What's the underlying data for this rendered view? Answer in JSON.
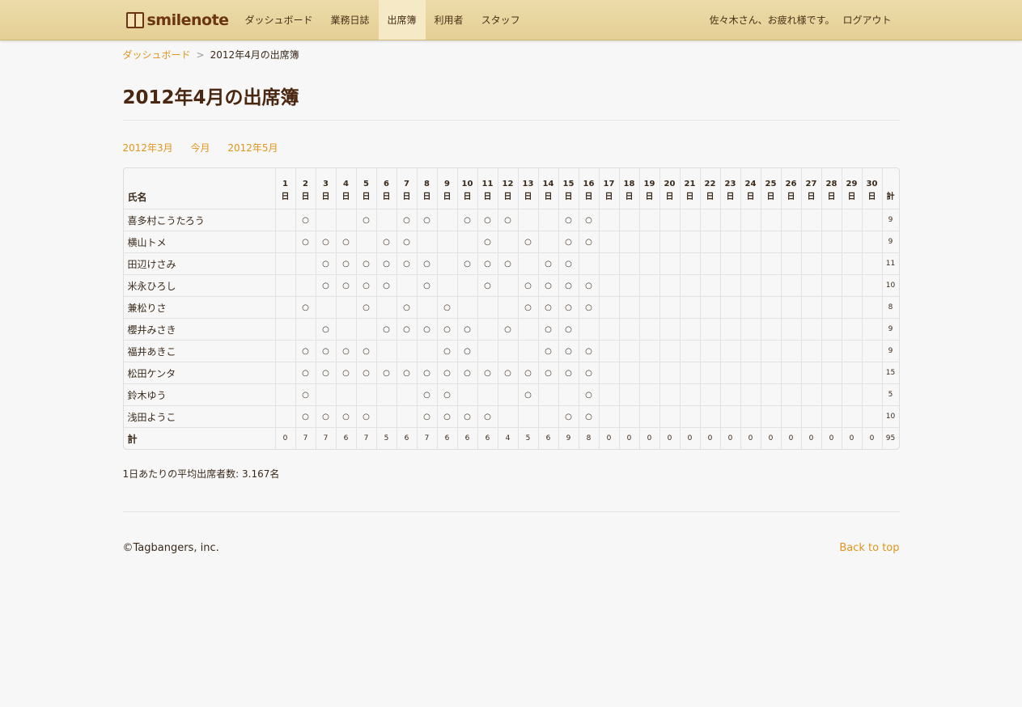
{
  "nav": {
    "brand": "smilenote",
    "items": [
      {
        "label": "ダッシュボード",
        "active": false
      },
      {
        "label": "業務日誌",
        "active": false
      },
      {
        "label": "出席簿",
        "active": true
      },
      {
        "label": "利用者",
        "active": false
      },
      {
        "label": "スタッフ",
        "active": false
      }
    ],
    "greeting": "佐々木さん、お疲れ様です。",
    "logout": "ログアウト"
  },
  "breadcrumb": {
    "home": "ダッシュボード",
    "separator": ">",
    "current": "2012年4月の出席簿"
  },
  "page_title": "2012年4月の出席簿",
  "month_nav": {
    "prev": "2012年3月",
    "current": "今月",
    "next": "2012年5月"
  },
  "table": {
    "name_header": "氏名",
    "day_suffix": "日",
    "total_header": "計",
    "mark": "○",
    "days": [
      1,
      2,
      3,
      4,
      5,
      6,
      7,
      8,
      9,
      10,
      11,
      12,
      13,
      14,
      15,
      16,
      17,
      18,
      19,
      20,
      21,
      22,
      23,
      24,
      25,
      26,
      27,
      28,
      29,
      30
    ],
    "rows": [
      {
        "name": "喜多村こうたろう",
        "days": [
          2,
          5,
          7,
          8,
          10,
          11,
          12,
          15,
          16
        ],
        "total": 9
      },
      {
        "name": "横山トメ",
        "days": [
          2,
          3,
          4,
          6,
          7,
          11,
          13,
          15,
          16
        ],
        "total": 9
      },
      {
        "name": "田辺けさみ",
        "days": [
          3,
          4,
          5,
          6,
          7,
          8,
          10,
          11,
          12,
          14,
          15
        ],
        "total": 11
      },
      {
        "name": "米永ひろし",
        "days": [
          3,
          4,
          5,
          6,
          8,
          11,
          13,
          14,
          15,
          16
        ],
        "total": 10
      },
      {
        "name": "兼松りさ",
        "days": [
          2,
          5,
          7,
          9,
          13,
          14,
          15,
          16
        ],
        "total": 8
      },
      {
        "name": "櫻井みさき",
        "days": [
          3,
          6,
          7,
          8,
          9,
          10,
          12,
          14,
          15
        ],
        "total": 9
      },
      {
        "name": "福井あきこ",
        "days": [
          2,
          3,
          4,
          5,
          9,
          10,
          14,
          15,
          16
        ],
        "total": 9
      },
      {
        "name": "松田ケンタ",
        "days": [
          2,
          3,
          4,
          5,
          6,
          7,
          8,
          9,
          10,
          11,
          12,
          13,
          14,
          15,
          16
        ],
        "total": 15
      },
      {
        "name": "鈴木ゆう",
        "days": [
          2,
          8,
          9,
          13,
          16
        ],
        "total": 5
      },
      {
        "name": "浅田ようこ",
        "days": [
          2,
          3,
          4,
          5,
          8,
          9,
          10,
          11,
          15,
          16
        ],
        "total": 10
      }
    ],
    "sum_label": "計",
    "day_totals": [
      0,
      7,
      7,
      6,
      7,
      5,
      6,
      7,
      6,
      6,
      6,
      4,
      5,
      6,
      9,
      8,
      0,
      0,
      0,
      0,
      0,
      0,
      0,
      0,
      0,
      0,
      0,
      0,
      0,
      0
    ],
    "grand_total": 95
  },
  "average_text": "1日あたりの平均出席者数: 3.167名",
  "footer": {
    "copyright": "©Tagbangers, inc.",
    "back_to_top": "Back to top"
  }
}
